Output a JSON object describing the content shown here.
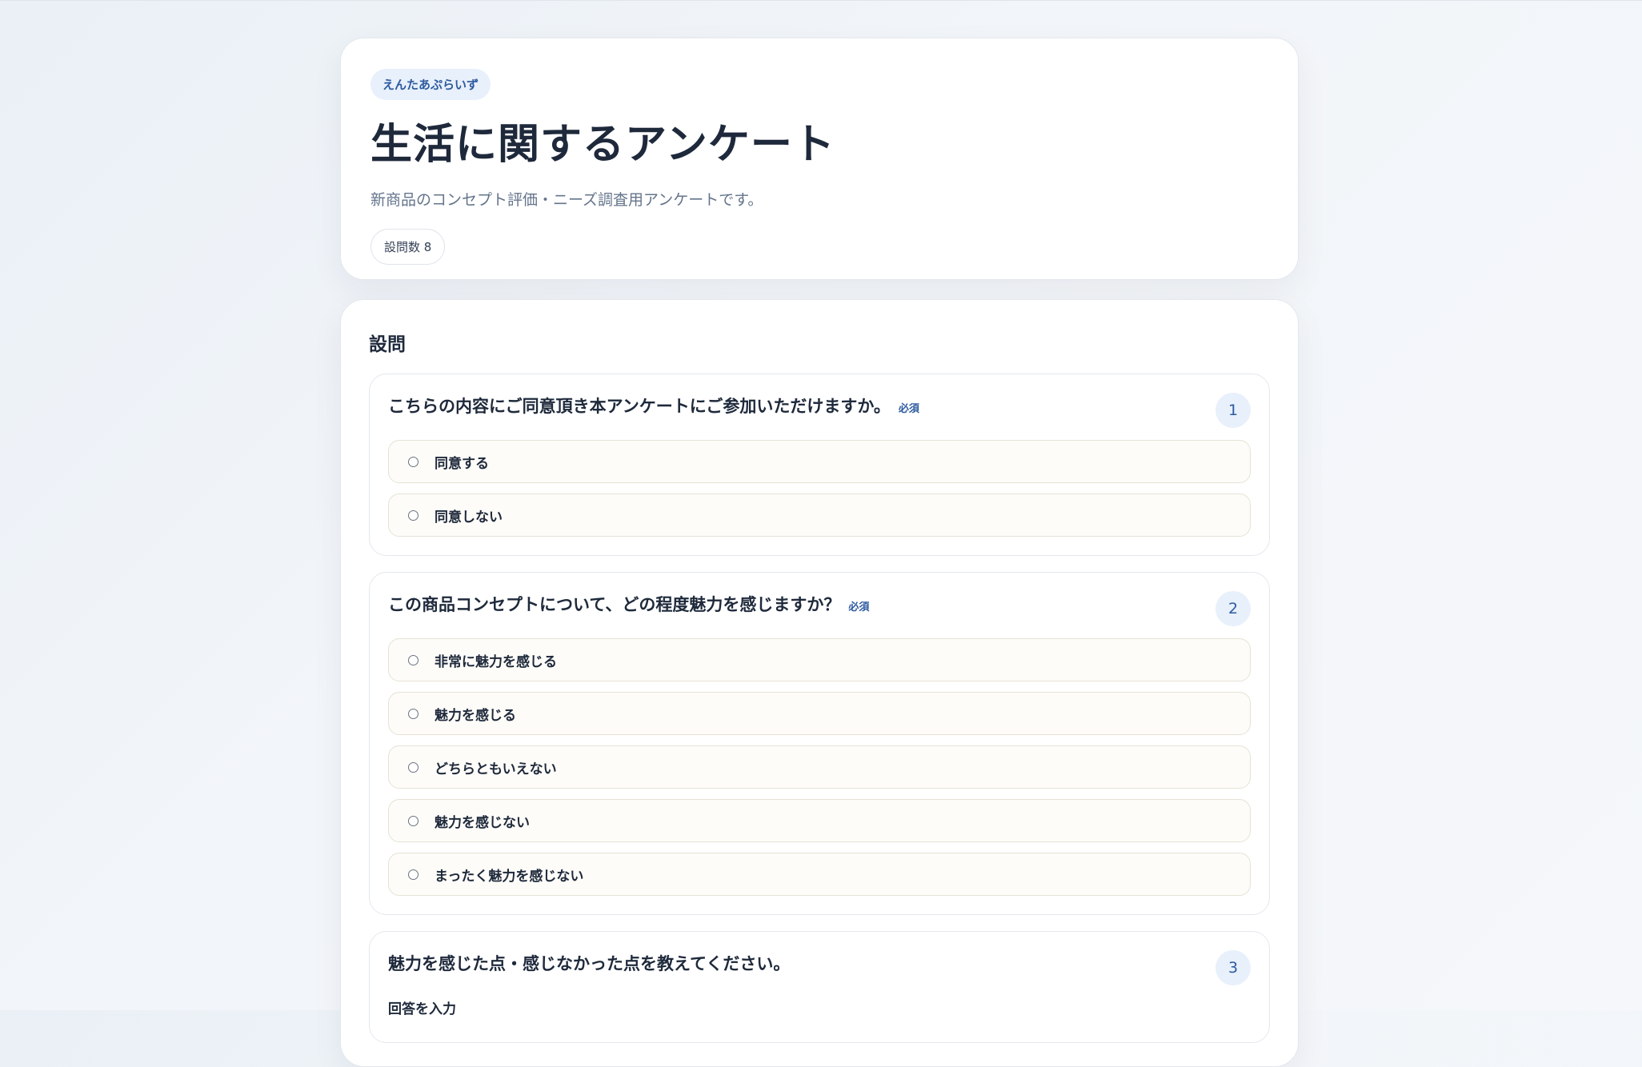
{
  "header": {
    "brand": "えんたあぷらいず",
    "title": "生活に関するアンケート",
    "subtitle": "新商品のコンセプト評価・ニーズ調査用アンケートです。",
    "question_count": "設問数 8"
  },
  "questions_section": {
    "title": "設問",
    "required_label": "必須",
    "questions": [
      {
        "number": "1",
        "text": "こちらの内容にご同意頂き本アンケートにご参加いただけますか。",
        "required": true,
        "options": [
          "同意する",
          "同意しない"
        ]
      },
      {
        "number": "2",
        "text": "この商品コンセプトについて、どの程度魅力を感じますか？",
        "required": true,
        "options": [
          "非常に魅力を感じる",
          "魅力を感じる",
          "どちらともいえない",
          "魅力を感じない",
          "まったく魅力を感じない"
        ]
      },
      {
        "number": "3",
        "text": "魅力を感じた点・感じなかった点を教えてください。",
        "required": false,
        "answer_label": "回答を入力"
      }
    ]
  },
  "colors": {
    "accent": "#2d5aa0",
    "chip_bg": "#e8f0fb",
    "option_bg": "#fdfcf8",
    "text": "#1e293b",
    "muted": "#64748b"
  }
}
